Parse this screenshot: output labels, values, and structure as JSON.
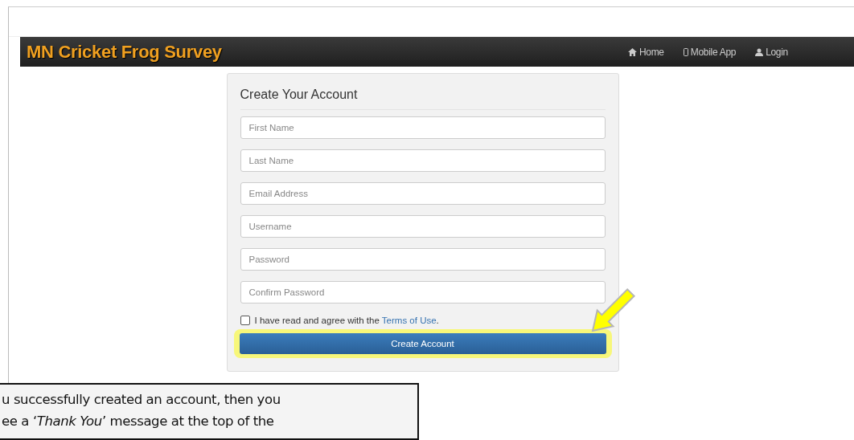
{
  "navbar": {
    "brand": "MN Cricket Frog Survey",
    "links": [
      {
        "kind": "home",
        "label": "Home"
      },
      {
        "kind": "mobile",
        "label": "Mobile App"
      },
      {
        "kind": "user",
        "label": "Login"
      }
    ]
  },
  "form": {
    "title": "Create Your Account",
    "fields": [
      {
        "placeholder": "First Name"
      },
      {
        "placeholder": "Last Name"
      },
      {
        "placeholder": "Email Address"
      },
      {
        "placeholder": "Username"
      },
      {
        "placeholder": "Password"
      },
      {
        "placeholder": "Confirm Password"
      }
    ],
    "terms": {
      "checked": false,
      "text": "I have read and agree with the ",
      "link": "Terms of Use",
      "after": "."
    },
    "submit": "Create Account"
  },
  "callout": {
    "lines": [
      "u successfully created an account, then you",
      "ee a ‘*Thank You*’ message at the top of the"
    ]
  }
}
